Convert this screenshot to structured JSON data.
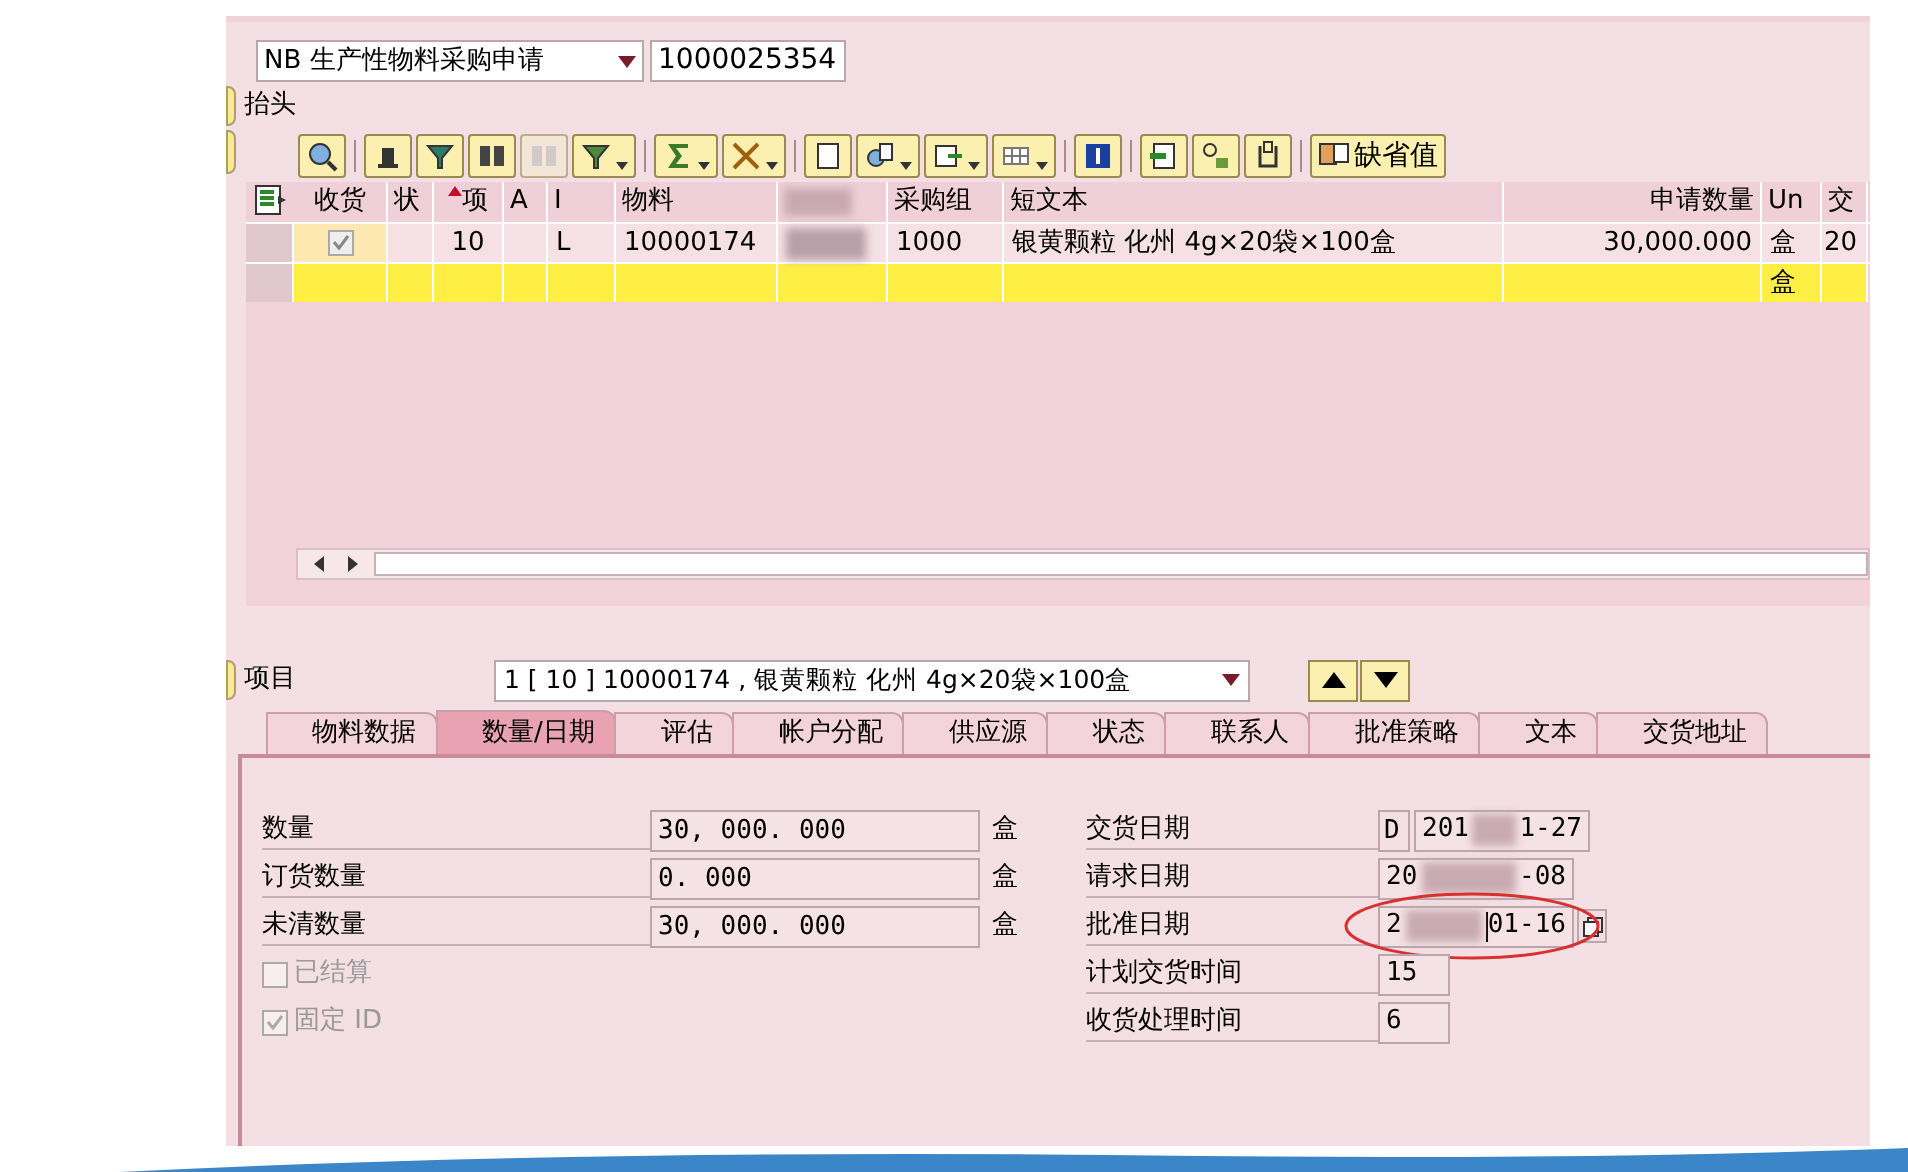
{
  "header": {
    "doc_type": "NB 生产性物料采购申请",
    "doc_number": "1000025354",
    "section_label": "抬头"
  },
  "toolbar": [
    {
      "kind": "button",
      "disabled": false
    },
    {
      "kind": "separator"
    },
    {
      "kind": "button",
      "disabled": false
    },
    {
      "kind": "button",
      "disabled": false
    },
    {
      "kind": "button",
      "disabled": false
    },
    {
      "kind": "button",
      "disabled": true
    },
    {
      "kind": "menu",
      "disabled": false
    },
    {
      "kind": "separator"
    },
    {
      "kind": "menu",
      "disabled": false
    },
    {
      "kind": "menu",
      "disabled": false
    },
    {
      "kind": "separator"
    },
    {
      "kind": "button",
      "disabled": false
    },
    {
      "kind": "menu",
      "disabled": false
    },
    {
      "kind": "menu",
      "disabled": false
    },
    {
      "kind": "menu",
      "disabled": false
    },
    {
      "kind": "separator"
    },
    {
      "kind": "button",
      "disabled": false
    },
    {
      "kind": "separator"
    },
    {
      "kind": "button",
      "disabled": false
    },
    {
      "kind": "button",
      "disabled": false
    },
    {
      "kind": "button",
      "disabled": false
    },
    {
      "kind": "separator"
    },
    {
      "kind": "labeled",
      "disabled": false,
      "label": "缺省值"
    }
  ],
  "table": {
    "columns": [
      {
        "label": "收货"
      },
      {
        "label": "状"
      },
      {
        "label": "项",
        "sorted": true
      },
      {
        "label": "A"
      },
      {
        "label": "I"
      },
      {
        "label": "物料"
      },
      {
        "blurred": true
      },
      {
        "label": "采购组"
      },
      {
        "label": "短文本"
      },
      {
        "label": "申请数量"
      },
      {
        "label": "Un"
      },
      {
        "label": "交"
      }
    ],
    "rows": [
      {
        "kind": "item",
        "cells": [
          {
            "kind": "checkbox",
            "checked": true
          },
          {
            "text": ""
          },
          {
            "text": "10"
          },
          {
            "text": ""
          },
          {
            "text": "L"
          },
          {
            "text": "10000174"
          },
          {
            "kind": "blurred"
          },
          {
            "text": "1000"
          },
          {
            "text": "银黄颗粒 化州 4g×20袋×100盒"
          },
          {
            "text": "30,000.000"
          },
          {
            "text": "盒"
          },
          {
            "text": "20"
          }
        ]
      },
      {
        "kind": "new",
        "cells": [
          {
            "text": ""
          },
          {
            "text": ""
          },
          {
            "text": ""
          },
          {
            "text": ""
          },
          {
            "text": ""
          },
          {
            "text": ""
          },
          {
            "text": ""
          },
          {
            "text": ""
          },
          {
            "text": ""
          },
          {
            "text": ""
          },
          {
            "text": "盒"
          },
          {
            "text": ""
          }
        ]
      }
    ]
  },
  "item_bar": {
    "label": "项目",
    "value": "1 [ 10 ] 10000174 , 银黄颗粒 化州 4g×20袋×100盒"
  },
  "tabs": [
    {
      "label": "物料数据",
      "selected": false
    },
    {
      "label": "数量/日期",
      "selected": true
    },
    {
      "label": "评估",
      "selected": false
    },
    {
      "label": "帐户分配",
      "selected": false
    },
    {
      "label": "供应源",
      "selected": false
    },
    {
      "label": "状态",
      "selected": false
    },
    {
      "label": "联系人",
      "selected": false
    },
    {
      "label": "批准策略",
      "selected": false
    },
    {
      "label": "文本",
      "selected": false
    },
    {
      "label": "交货地址",
      "selected": false
    }
  ],
  "quantities": [
    {
      "label": "数量",
      "value": "30, 000. 000",
      "unit": "盒"
    },
    {
      "label": "订货数量",
      "value": "0. 000",
      "unit": "盒"
    },
    {
      "label": "未清数量",
      "value": "30, 000. 000",
      "unit": "盒"
    }
  ],
  "flags": [
    {
      "label": "已结算",
      "checked": false,
      "disabled": true
    },
    {
      "label": "固定 ID",
      "checked": true,
      "disabled": true
    }
  ],
  "dates": [
    {
      "label": "交货日期",
      "prefix": "D",
      "start": "201",
      "end": "1-27",
      "blurred": true
    },
    {
      "label": "请求日期",
      "start": "20",
      "end": "-08",
      "blurred": true
    },
    {
      "label": "批准日期",
      "start": "2",
      "end": "01-16",
      "blurred": true,
      "highlighted": true,
      "cursor": true
    },
    {
      "label": "计划交货时间",
      "start": "15"
    },
    {
      "label": "收货处理时间",
      "start": "6"
    }
  ]
}
